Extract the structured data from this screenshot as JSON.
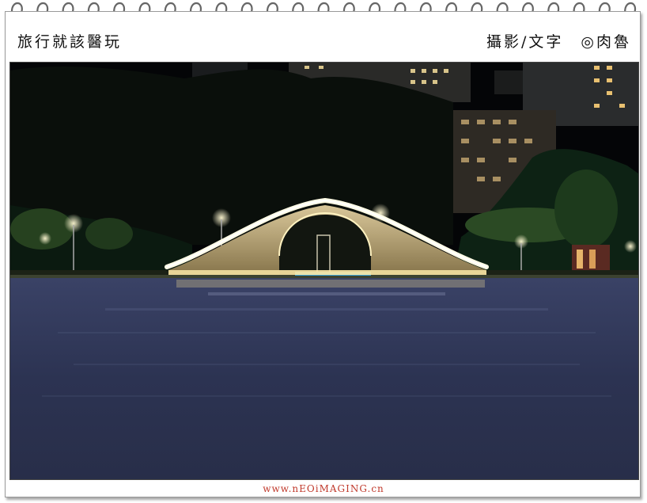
{
  "header": {
    "left_title": "旅行就該醫玩",
    "right_credit": "攝影/文字　◎肉魯"
  },
  "photo": {
    "subject": "night-arch-bridge-over-lake",
    "colors": {
      "sky": "#050608",
      "water": "#2c3454",
      "bridge_light": "#fff6c8",
      "lamp": "#ffe39a"
    }
  },
  "footer": {
    "watermark": "www.nEOiMAGING.cn"
  }
}
